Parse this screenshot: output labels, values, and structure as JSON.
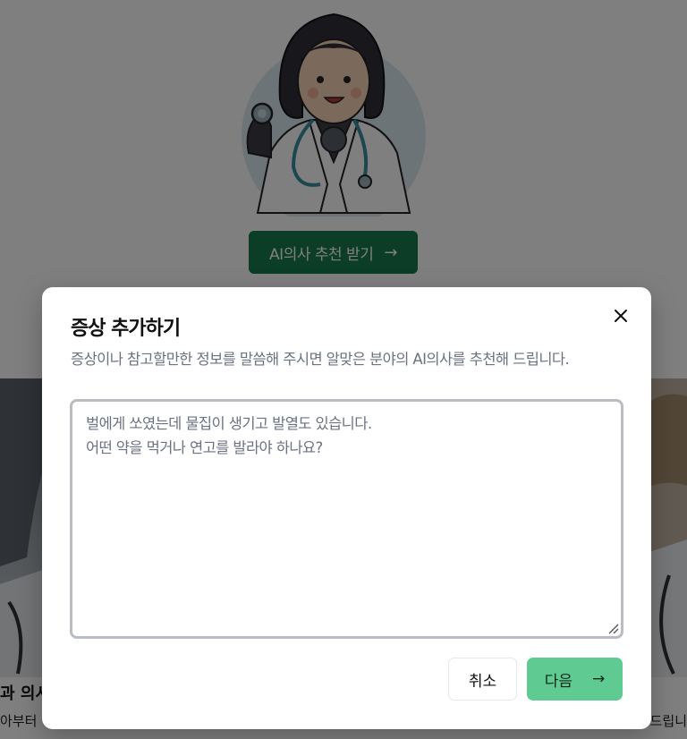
{
  "background": {
    "cta_label": "AI의사 추천 받기",
    "card_left_title": "과 의시",
    "card_left_desc": "아부터",
    "card_right_desc": "드립니"
  },
  "modal": {
    "title": "증상 추가하기",
    "description": "증상이나 참고할만한 정보를 말씀해 주시면 알맞은 분야의 AI의사를 추천해 드립니다.",
    "input_value": "벌에게 쏘였는데 물집이 생기고 발열도 있습니다.\n어떤 약을 먹거나 연고를 발라야 하나요?",
    "cancel_label": "취소",
    "next_label": "다음"
  },
  "colors": {
    "cta": "#167a4f",
    "next_button": "#5fcb93",
    "overlay": "rgba(0,0,0,0.5)"
  },
  "icons": [
    "doctor-illustration",
    "arrow-right-icon",
    "close-icon",
    "resize-grip-icon"
  ]
}
